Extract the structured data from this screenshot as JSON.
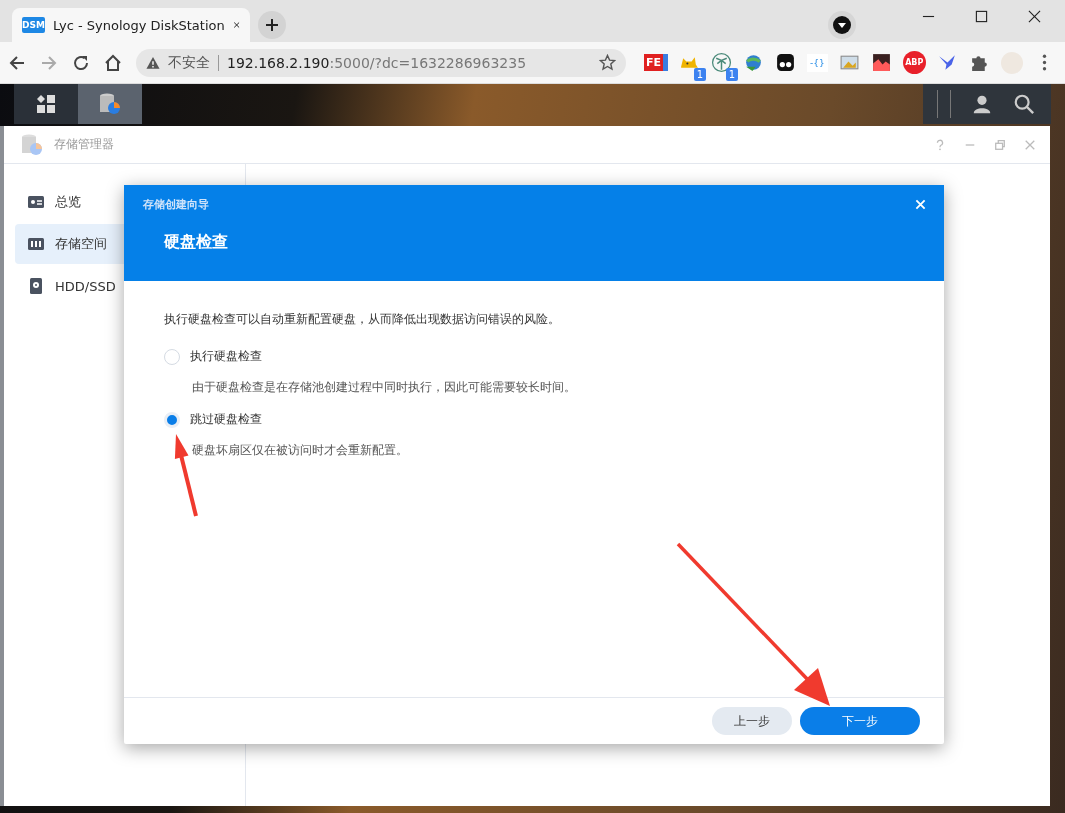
{
  "browser": {
    "tab": {
      "favicon": "DSM",
      "title": "Lyc - Synology DiskStation"
    },
    "address": {
      "security": "不安全",
      "host": "192.168.2.190",
      "rest": ":5000/?dc=1632286963235"
    },
    "extensions": [
      {
        "kind": "fe",
        "label": "FE"
      },
      {
        "kind": "cat",
        "badge": "1"
      },
      {
        "kind": "palm",
        "badge": "1"
      },
      {
        "kind": "globe"
      },
      {
        "kind": "ghost"
      },
      {
        "kind": "json",
        "label": "-{}"
      },
      {
        "kind": "image"
      },
      {
        "kind": "chart"
      },
      {
        "kind": "abp",
        "label": "ABP"
      },
      {
        "kind": "bird"
      },
      {
        "kind": "puzzle"
      },
      {
        "kind": "avatar"
      }
    ]
  },
  "app_window": {
    "title": "存储管理器",
    "sidebar": [
      {
        "kind": "overview",
        "label": "总览",
        "selected": false
      },
      {
        "kind": "storage",
        "label": "存储空间",
        "selected": true
      },
      {
        "kind": "disk",
        "label": "HDD/SSD",
        "selected": false
      }
    ]
  },
  "dialog": {
    "app_title": "存储创建向导",
    "heading": "硬盘检查",
    "intro": "执行硬盘检查可以自动重新配置硬盘，从而降低出现数据访问错误的风险。",
    "options": [
      {
        "label": "执行硬盘检查",
        "description": "由于硬盘检查是在存储池创建过程中同时执行，因此可能需要较长时间。",
        "selected": false
      },
      {
        "label": "跳过硬盘检查",
        "description": "硬盘坏扇区仅在被访问时才会重新配置。",
        "selected": true
      }
    ],
    "buttons": [
      {
        "label": "上一步",
        "primary": false
      },
      {
        "label": "下一步",
        "primary": true
      }
    ]
  }
}
